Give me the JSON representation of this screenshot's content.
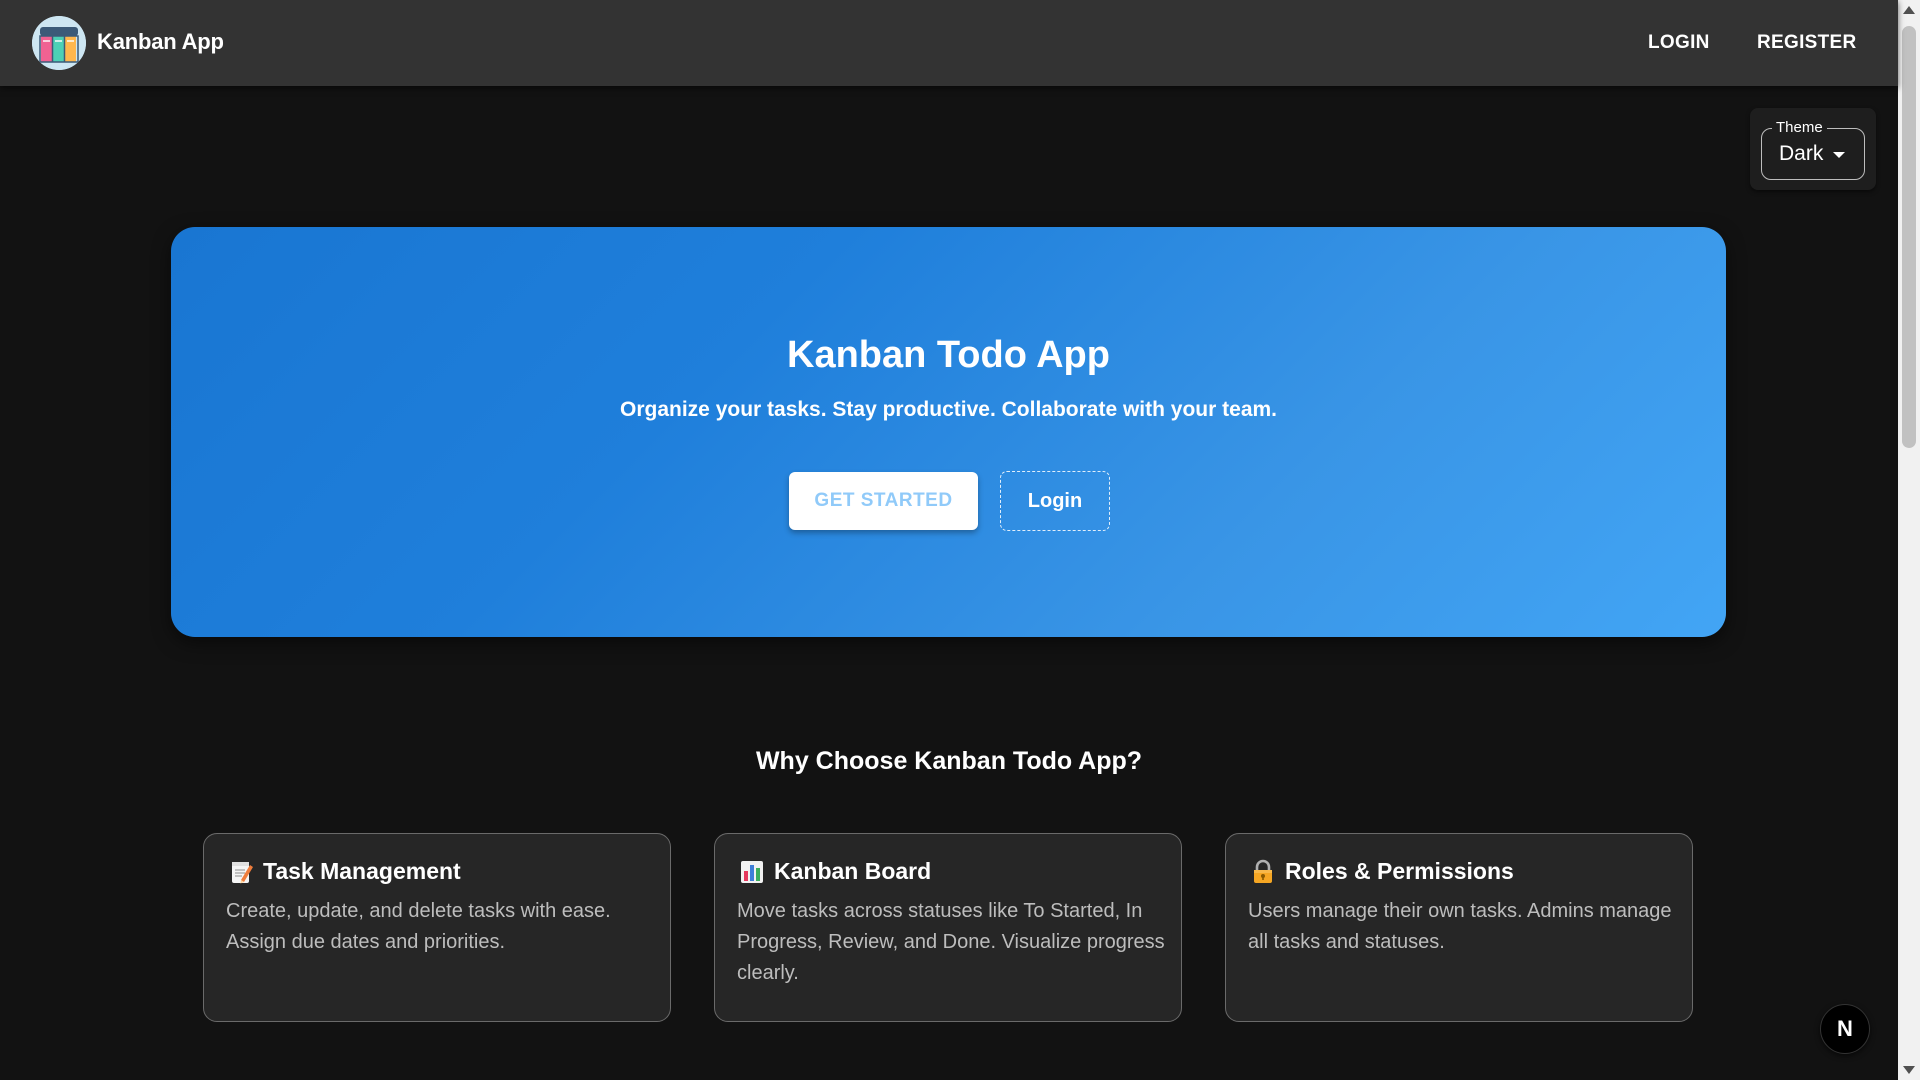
{
  "app": {
    "name": "Kanban App"
  },
  "nav": {
    "login_label": "LOGIN",
    "register_label": "REGISTER"
  },
  "theme_selector": {
    "label": "Theme",
    "value": "Dark"
  },
  "hero": {
    "title": "Kanban Todo App",
    "subtitle": "Organize your tasks. Stay productive. Collaborate with your team.",
    "primary_button": "GET STARTED",
    "secondary_button": "Login"
  },
  "features": {
    "title": "Why Choose Kanban Todo App?",
    "cards": [
      {
        "icon": "memo-icon",
        "title": "Task Management",
        "description": "Create, update, and delete tasks with ease. Assign due dates and priorities."
      },
      {
        "icon": "bar-chart-icon",
        "title": "Kanban Board",
        "description": "Move tasks across statuses like To Started, In Progress, Review, and Done. Visualize progress clearly."
      },
      {
        "icon": "lock-icon",
        "title": "Roles & Permissions",
        "description": "Users manage their own tasks. Admins manage all tasks and statuses."
      }
    ]
  },
  "dev_badge": {
    "letter": "N",
    "icon": "nextjs-icon"
  },
  "colors": {
    "appbar": "#333333",
    "background": "#121212",
    "hero_start": "#1976d2",
    "hero_end": "#42a5f5",
    "card_bg": "#262626",
    "primary_button_text": "#90caf9"
  }
}
